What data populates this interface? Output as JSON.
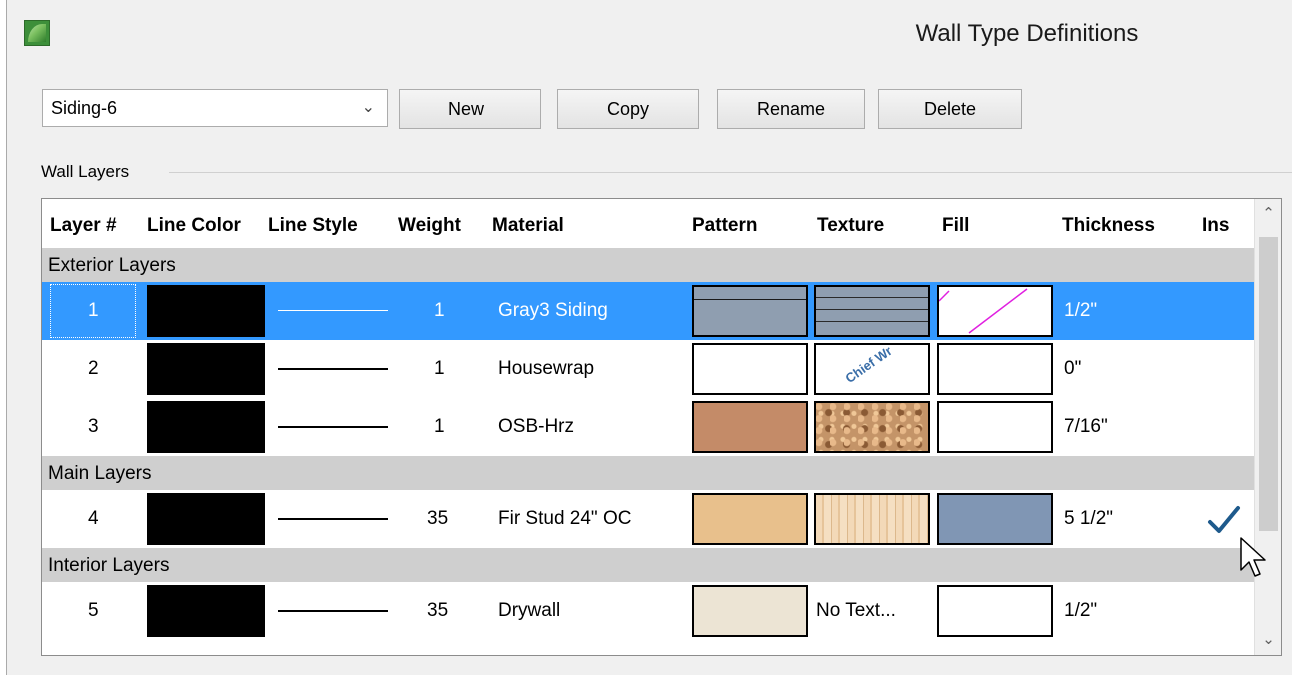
{
  "window": {
    "title": "Wall Type Definitions"
  },
  "toolbar": {
    "selected_type": "Siding-6",
    "new_label": "New",
    "copy_label": "Copy",
    "rename_label": "Rename",
    "delete_label": "Delete"
  },
  "group": {
    "label": "Wall Layers"
  },
  "columns": [
    "Layer #",
    "Line Color",
    "Line Style",
    "Weight",
    "Material",
    "Pattern",
    "Texture",
    "Fill",
    "Thickness",
    "Ins"
  ],
  "sections": {
    "exterior": "Exterior Layers",
    "main": "Main Layers",
    "interior": "Interior Layers"
  },
  "rows": [
    {
      "layer": "1",
      "weight": "1",
      "material": "Gray3 Siding",
      "thickness": "1/2\"",
      "insulation": false,
      "selected": true,
      "pattern_color": "#8f9eb0",
      "texture": "gray-siding",
      "fill": "magenta-diagonal"
    },
    {
      "layer": "2",
      "weight": "1",
      "material": "Housewrap",
      "thickness": "0\"",
      "insulation": false,
      "selected": false,
      "pattern_color": "#ffffff",
      "texture": "housewrap-print",
      "texture_text": "Chief Wr",
      "fill": "white"
    },
    {
      "layer": "3",
      "weight": "1",
      "material": "OSB-Hrz",
      "thickness": "7/16\"",
      "insulation": false,
      "selected": false,
      "pattern_color": "#c48b68",
      "texture": "osb-speckle",
      "fill": "white"
    },
    {
      "layer": "4",
      "weight": "35",
      "material": "Fir Stud 24\" OC",
      "thickness": "5 1/2\"",
      "insulation": true,
      "selected": false,
      "pattern_color": "#e8c08c",
      "texture": "wood-grain",
      "fill": "#8096b4"
    },
    {
      "layer": "5",
      "weight": "35",
      "material": "Drywall",
      "thickness": "1/2\"",
      "insulation": false,
      "selected": false,
      "pattern_color": "#ece4d4",
      "texture_text": "No Text...",
      "fill": "white"
    }
  ],
  "colors": {
    "selection": "#3399ff",
    "section_band": "#cfcfcf",
    "check": "#1e5a8c"
  }
}
